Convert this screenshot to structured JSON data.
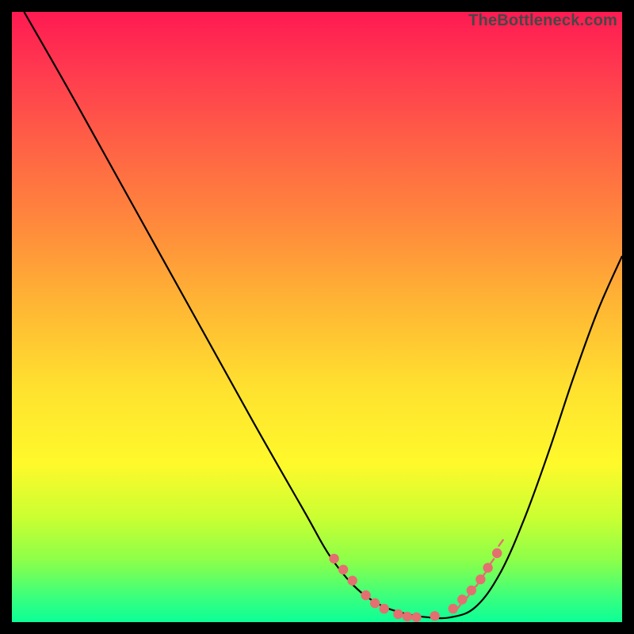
{
  "watermark": "TheBottleneck.com",
  "chart_data": {
    "type": "line",
    "title": "",
    "xlabel": "",
    "ylabel": "",
    "xlim": [
      0,
      100
    ],
    "ylim": [
      0,
      100
    ],
    "series": [
      {
        "name": "bottleneck-curve",
        "x": [
          2,
          10,
          20,
          30,
          40,
          48,
          52,
          56,
          60,
          64,
          68,
          72,
          76,
          80,
          84,
          88,
          92,
          96,
          100
        ],
        "y": [
          100,
          86,
          68,
          50,
          32,
          18,
          11,
          6,
          3,
          1.5,
          0.8,
          0.8,
          2.5,
          8,
          17,
          28,
          40,
          51,
          60
        ]
      }
    ],
    "markers": {
      "name": "highlight-points",
      "color": "#e46f70",
      "x": [
        52.8,
        54.3,
        55.8,
        58.0,
        59.5,
        61.0,
        63.3,
        64.8,
        66.3,
        69.3,
        72.3,
        73.8,
        75.3,
        76.8,
        78.0,
        79.5
      ],
      "y": [
        10.4,
        8.6,
        6.8,
        4.4,
        3.1,
        2.2,
        1.3,
        0.9,
        0.8,
        1.0,
        2.2,
        3.7,
        5.2,
        7.0,
        8.9,
        11.3
      ]
    },
    "ticks": {
      "name": "short-ticks",
      "color": "#e46f70",
      "x": [
        73.1,
        73.8,
        74.6,
        75.3,
        76.1,
        76.8,
        77.6,
        78.3,
        79.1,
        79.8
      ],
      "y": [
        2.3,
        3.1,
        4.0,
        4.9,
        5.9,
        7.0,
        8.1,
        9.4,
        10.8,
        12.5
      ]
    }
  }
}
